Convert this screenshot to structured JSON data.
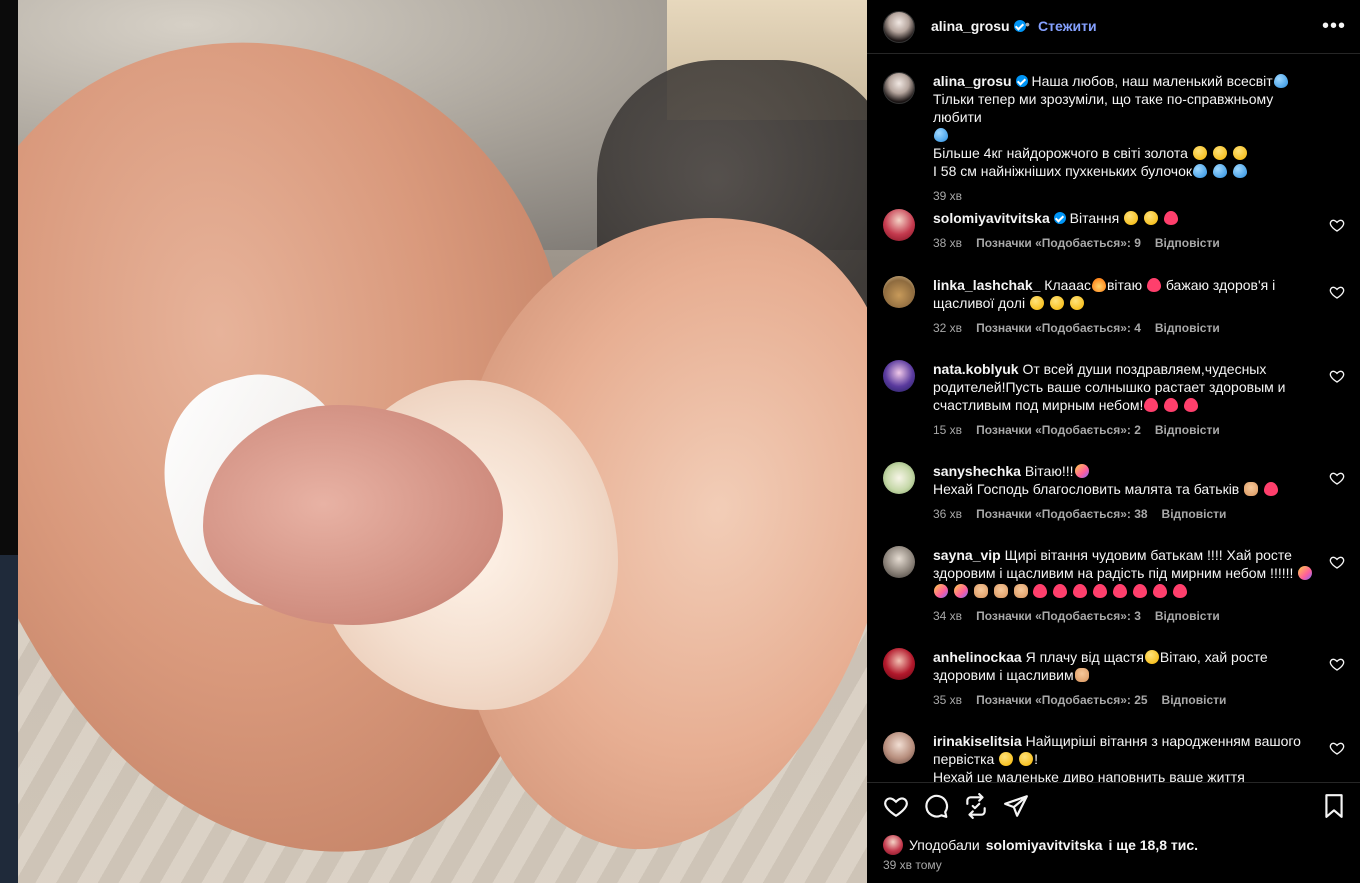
{
  "post": {
    "author": "alina_grosu",
    "follow_label": "Стежити",
    "separator": "•",
    "more_label": "•••"
  },
  "caption": {
    "user": "alina_grosu",
    "line1": "Наша любов, наш маленький всесвіт",
    "line2": "Тільки тепер ми зрозуміли, що таке по-справжньому любити",
    "line3": "Більше 4кг найдорожчого в світі золота",
    "line4": "І 58 см найніжніших пухкеньких булочок",
    "time": "39 хв"
  },
  "comments": [
    {
      "user": "solomiyavitvitska",
      "verified": true,
      "text": "Вітання",
      "time": "38 хв",
      "likes": "Позначки «Подобається»: 9",
      "reply": "Відповісти"
    },
    {
      "user": "linka_lashchak_",
      "text1": "Клааас",
      "text2": "вітаю",
      "text3": "бажаю здоров'я і щасливої долі",
      "time": "32 хв",
      "likes": "Позначки «Подобається»: 4",
      "reply": "Відповісти"
    },
    {
      "user": "nata.koblyuk",
      "text": "От всей души поздравляем,чудесных родителей!Пусть ваше солнышко растает здоровым и счастливым под мирным небом!",
      "time": "15 хв",
      "likes": "Позначки «Подобається»: 2",
      "reply": "Відповісти"
    },
    {
      "user": "sanyshechka",
      "text1": "Вітаю!!!",
      "text2": "Нехай Господь благословить малята та батьків",
      "time": "36 хв",
      "likes": "Позначки «Подобається»: 38",
      "reply": "Відповісти"
    },
    {
      "user": "sayna_vip",
      "text": "Щирі вітання чудовим батькам !!!! Хай росте здоровим і щасливим на радість під мирним небом !!!!!!",
      "time": "34 хв",
      "likes": "Позначки «Подобається»: 3",
      "reply": "Відповісти"
    },
    {
      "user": "anhelinockaa",
      "text1": "Я плачу від щастя",
      "text2": "Вітаю, хай росте здоровим і щасливим",
      "time": "35 хв",
      "likes": "Позначки «Подобається»: 25",
      "reply": "Відповісти"
    },
    {
      "user": "irinakiselitsia",
      "text1": "Найщиріші вітання з народженням вашого первістка",
      "text2": "!",
      "text3": "Нехай це маленьке диво наповнить ваше життя безмежною"
    }
  ],
  "likes_line": {
    "prefix": "Уподобали",
    "user": "solomiyavitvitska",
    "suffix": "і ще 18,8 тис."
  },
  "posted": "39 хв тому",
  "colors": {
    "verified": "#0095f6",
    "follow": "#85a1ff",
    "meta": "#a8a8a8",
    "background": "#000000"
  },
  "icons": [
    "heart-icon",
    "comment-icon",
    "share-icon",
    "send-icon",
    "bookmark-icon",
    "more-icon"
  ]
}
